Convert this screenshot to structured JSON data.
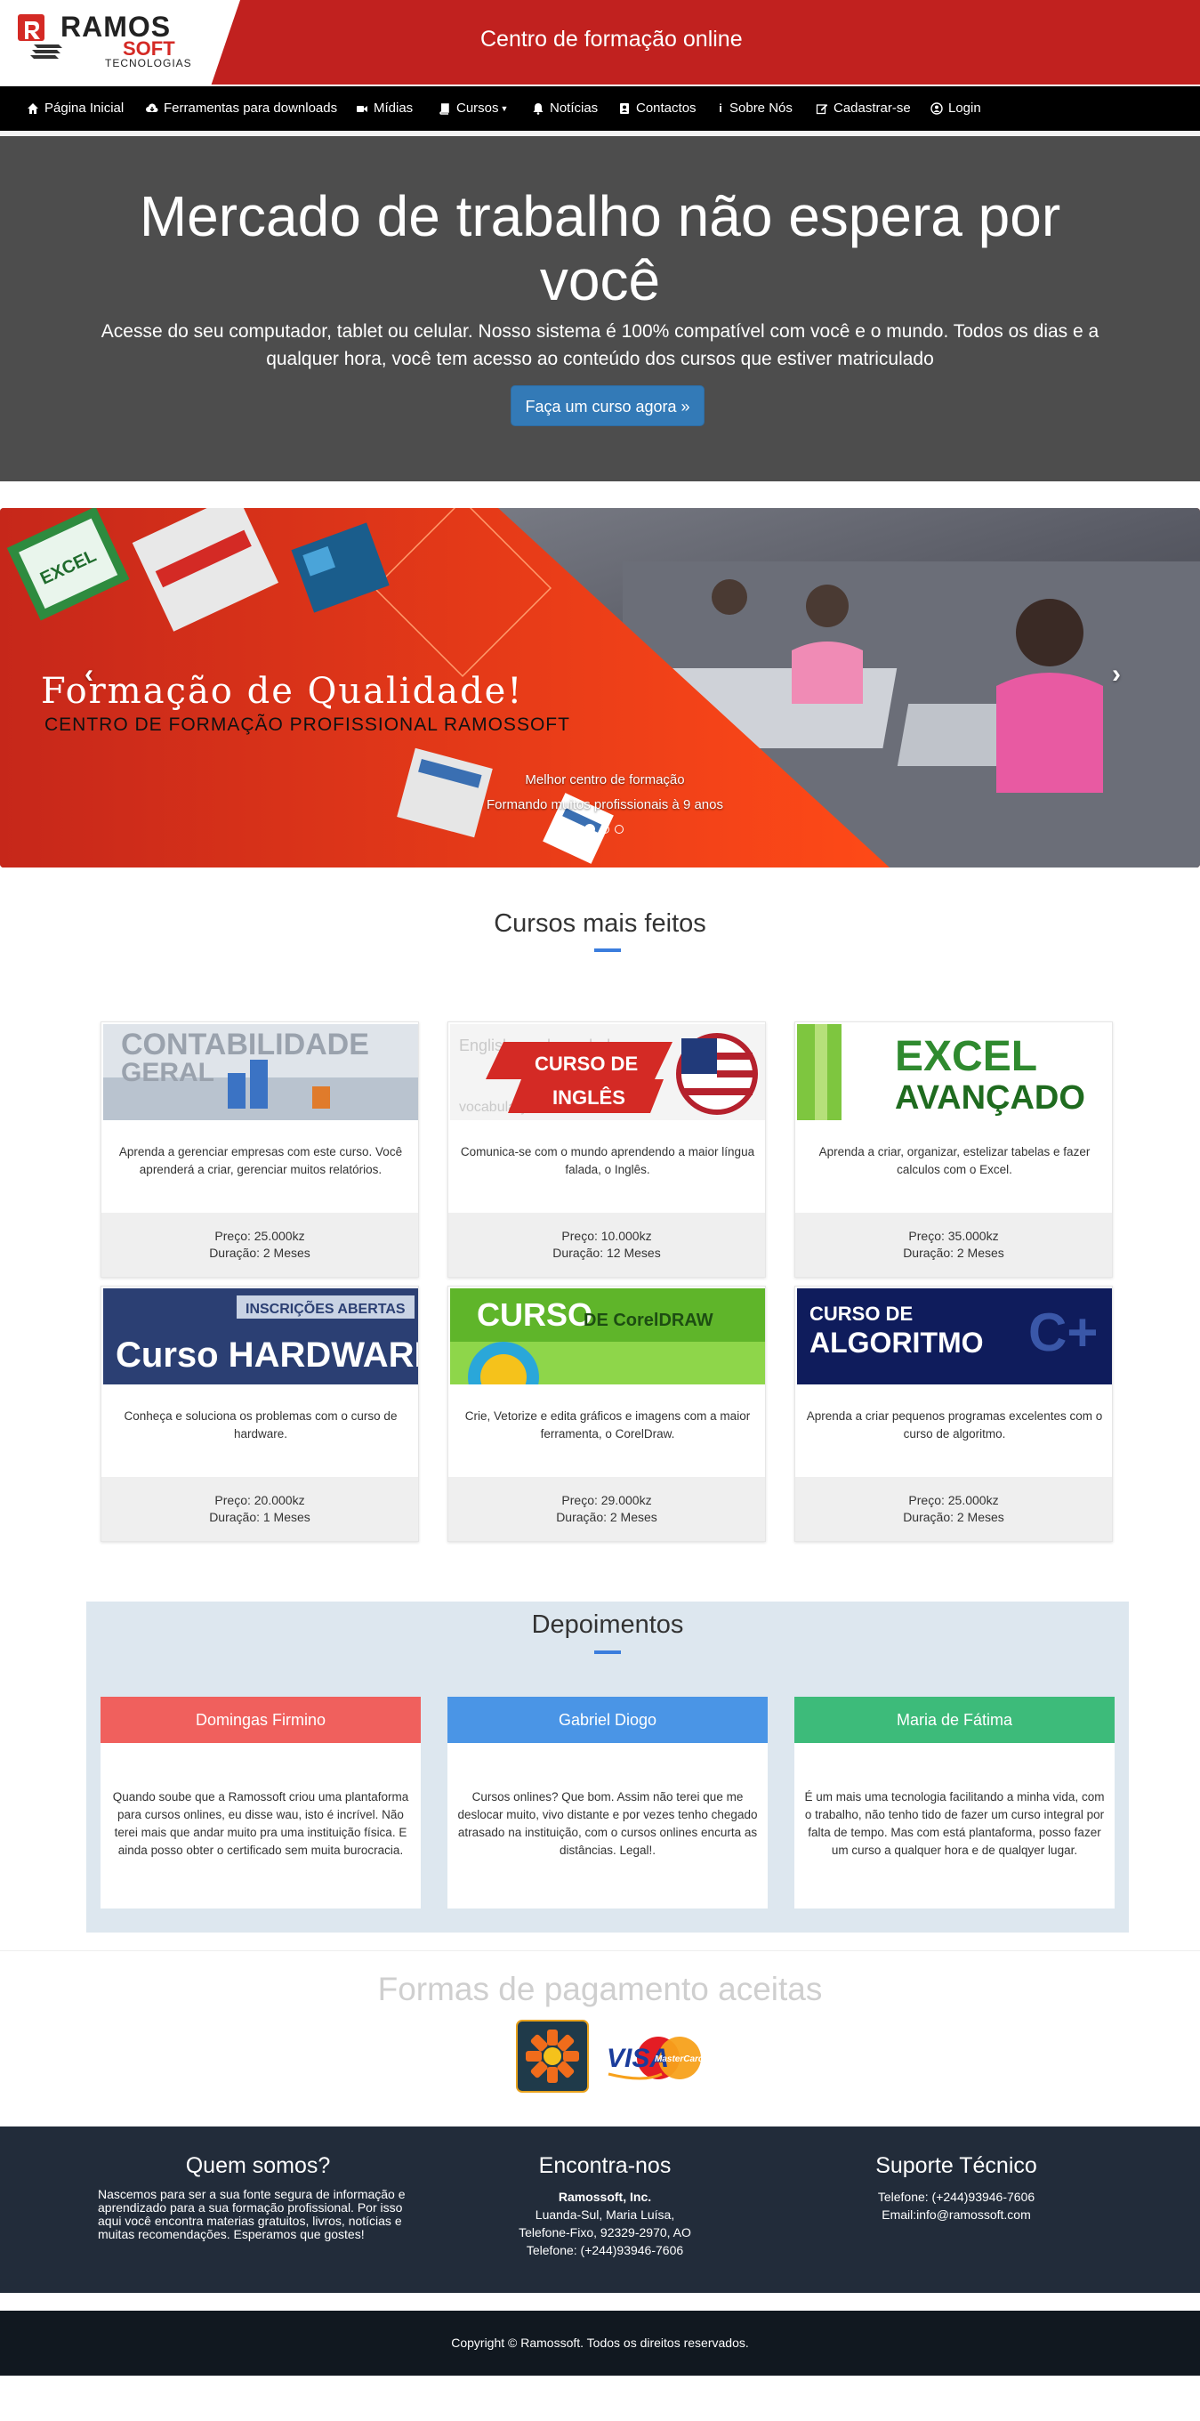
{
  "header": {
    "logo_line1": "RAMOS",
    "logo_line2": "SOFT",
    "logo_line3": "TECNOLOGIAS",
    "site_title": "Centro de formação online"
  },
  "nav": {
    "items": [
      {
        "label": "Página Inicial",
        "icon": "home-icon"
      },
      {
        "label": "Ferramentas para downloads",
        "icon": "cloud-download-icon"
      },
      {
        "label": "Mídias",
        "icon": "video-camera-icon"
      },
      {
        "label": "Cursos",
        "icon": "book-icon"
      },
      {
        "label": "Notícias",
        "icon": "bell-icon"
      },
      {
        "label": "Contactos",
        "icon": "contact-card-icon"
      },
      {
        "label": "Sobre Nós",
        "icon": "info-icon"
      },
      {
        "label": "Cadastrar-se",
        "icon": "edit-icon"
      },
      {
        "label": "Login",
        "icon": "user-circle-icon"
      }
    ]
  },
  "jumbotron": {
    "heading": "Mercado de trabalho não espera por você",
    "text": "Acesse do seu computador, tablet ou celular. Nosso sistema é 100% compatível com você e o mundo. Todos os dias e a qualquer hora, você tem acesso ao conteúdo dos cursos que estiver matriculado",
    "button": "Faça um curso agora »"
  },
  "carousel": {
    "headline": "Formação de Qualidade!",
    "subheadline": "CENTRO DE FORMAÇÃO PROFISSIONAL RAMOSSOFT",
    "caption_title": "Melhor centro de formação",
    "caption_text": "Formando muitos profissionais à 9 anos",
    "slide_count": 3,
    "active_slide": 1
  },
  "courses_section": {
    "title": "Cursos mais feitos",
    "courses": [
      {
        "image_text1": "CONTABILIDADE",
        "image_text2": "GERAL",
        "description": "Aprenda a gerenciar empresas com este curso. Você aprenderá a criar, gerenciar muitos relatórios.",
        "price": "Preço: 25.000kz",
        "duration": "Duração: 2 Meses"
      },
      {
        "image_text1": "CURSO DE",
        "image_text2": "INGLÊS",
        "description": "Comunica-se com o mundo aprendendo a maior língua falada, o Inglês.",
        "price": "Preço: 10.000kz",
        "duration": "Duração: 12 Meses"
      },
      {
        "image_text1": "EXCEL",
        "image_text2": "AVANÇADO",
        "description": "Aprenda a criar, organizar, estelizar tabelas e fazer calculos com o Excel.",
        "price": "Preço: 35.000kz",
        "duration": "Duração: 2 Meses"
      },
      {
        "image_text1": "INSCRIÇÕES ABERTAS",
        "image_text2": "Curso HARDWARE",
        "description": "Conheça e soluciona os problemas com o curso de hardware.",
        "price": "Preço: 20.000kz",
        "duration": "Duração: 1 Meses"
      },
      {
        "image_text1": "CURSO",
        "image_text2": "DE CorelDRAW",
        "description": "Crie, Vetorize e edita gráficos e imagens com a maior ferramenta, o CorelDraw.",
        "price": "Preço: 29.000kz",
        "duration": "Duração: 2 Meses"
      },
      {
        "image_text1": "CURSO DE",
        "image_text2": "ALGORITMO",
        "description": "Aprenda a criar pequenos programas excelentes com o curso de algoritmo.",
        "price": "Preço: 25.000kz",
        "duration": "Duração: 2 Meses"
      }
    ]
  },
  "testimonials": {
    "title": "Depoimentos",
    "items": [
      {
        "name": "Domingas Firmino",
        "color": "#f0605d",
        "text": "Quando soube que a Ramossoft criou uma plantaforma para cursos onlines, eu disse wau, isto é incrível. Não terei mais que andar muito pra uma instituição física. E ainda posso obter o certificado sem muita burocracia."
      },
      {
        "name": "Gabriel Diogo",
        "color": "#4a95e6",
        "text": "Cursos onlines? Que bom. Assim não terei que me deslocar muito, vivo distante e por vezes tenho chegado atrasado na instituição, com o cursos onlines encurta as distâncias. Legal!."
      },
      {
        "name": "Maria de Fátima",
        "color": "#3dbb7a",
        "text": "É um mais uma tecnologia facilitando a minha vida, com o trabalho, não tenho tido de fazer um curso integral por falta de tempo. Mas com está plantaforma, posso fazer um curso a qualquer hora e de qualqyer lugar."
      }
    ]
  },
  "payment": {
    "title": "Formas de pagamento aceitas",
    "methods": [
      "Multicaixa",
      "VISA",
      "MasterCard"
    ]
  },
  "footer": {
    "about_title": "Quem somos?",
    "about_lines": [
      "Nascemos para ser a sua fonte segura de informação e",
      "aprendizado para a sua formação profissional. Por isso",
      "aqui você encontra materias gratuitos, livros, notícias e",
      "muitas recomendações. Esperamos que gostes!"
    ],
    "find_title": "Encontra-nos",
    "find_company": "Ramossoft, Inc.",
    "find_lines": [
      "Luanda-Sul, Maria Luísa,",
      "Telefone-Fixo, 92329-2970, AO",
      "Telefone: (+244)93946-7606"
    ],
    "support_title": "Suporte Técnico",
    "support_phone": "Telefone: (+244)93946-7606",
    "support_email": "Email:info@ramossoft.com"
  },
  "copyright": "Copyright © Ramossoft. Todos os direitos reservados."
}
